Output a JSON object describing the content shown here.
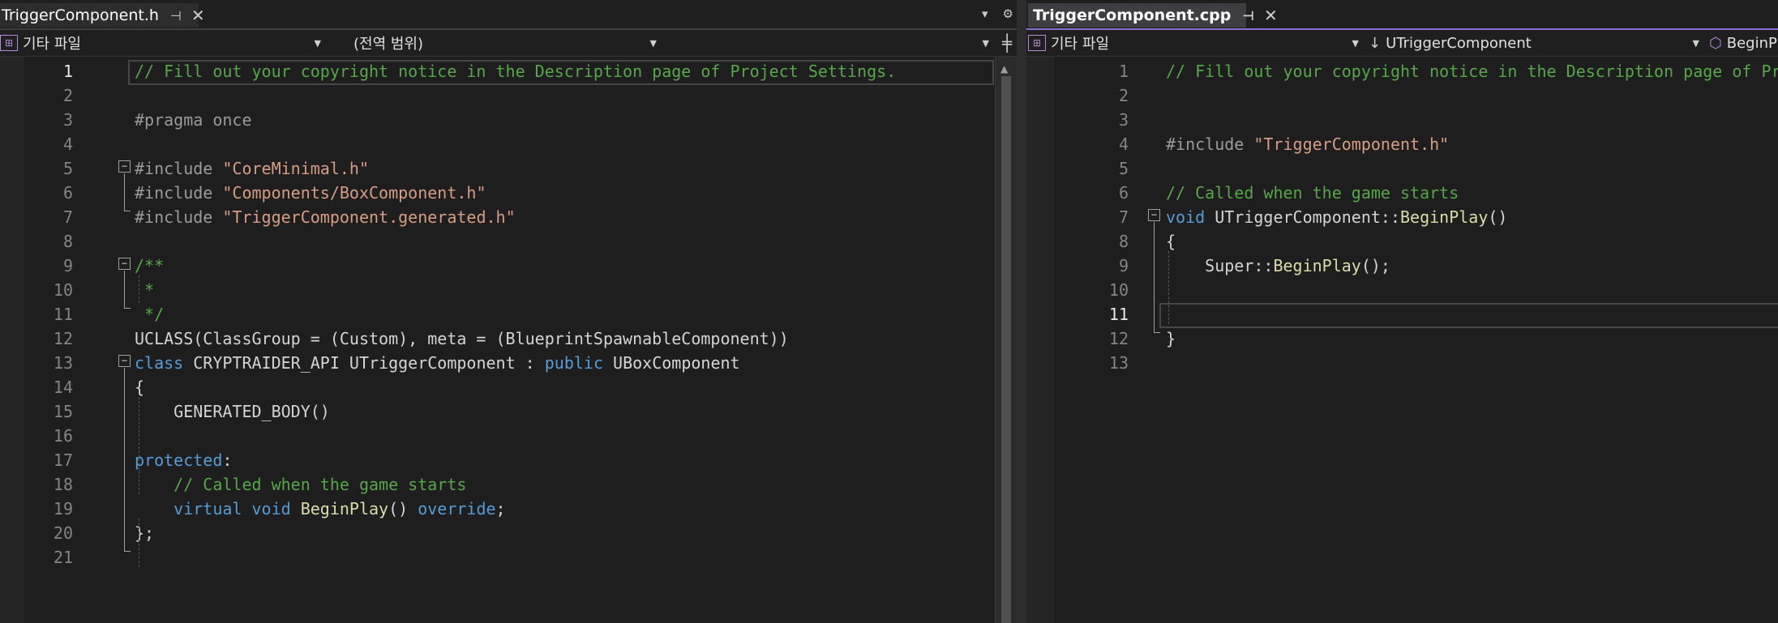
{
  "left": {
    "tab": {
      "title": "TriggerComponent.h",
      "pin_icon": "pin-icon",
      "close_icon": "close-icon"
    },
    "tabbar_tools": {
      "dropdown_glyph": "▾",
      "settings_glyph": "⚙"
    },
    "nav": {
      "project": "기타 파일",
      "scope": "(전역 범위)",
      "member": ""
    },
    "split_glyph": "╪",
    "active_line": 1,
    "lines": [
      [
        {
          "t": "// Fill out your copyright notice in the Description page of Project Settings.",
          "c": "cm"
        }
      ],
      [],
      [
        {
          "t": "#pragma once",
          "c": "pp"
        }
      ],
      [],
      [
        {
          "t": "#include ",
          "c": "pp"
        },
        {
          "t": "\"CoreMinimal.h\"",
          "c": "str"
        }
      ],
      [
        {
          "t": "#include ",
          "c": "pp"
        },
        {
          "t": "\"Components/BoxComponent.h\"",
          "c": "str"
        }
      ],
      [
        {
          "t": "#include ",
          "c": "pp"
        },
        {
          "t": "\"TriggerComponent.generated.h\"",
          "c": "str"
        }
      ],
      [],
      [
        {
          "t": "/**",
          "c": "cm"
        }
      ],
      [
        {
          "t": " *",
          "c": "cm"
        }
      ],
      [
        {
          "t": " */",
          "c": "cm"
        }
      ],
      [
        {
          "t": "UCLASS(ClassGroup = (Custom), meta = (BlueprintSpawnableComponent))",
          "c": "pl"
        }
      ],
      [
        {
          "t": "class ",
          "c": "kw"
        },
        {
          "t": "CRYPTRAIDER_API UTriggerComponent : ",
          "c": "pl"
        },
        {
          "t": "public ",
          "c": "kw"
        },
        {
          "t": "UBoxComponent",
          "c": "ty"
        }
      ],
      [
        {
          "t": "{",
          "c": "pl"
        }
      ],
      [
        {
          "t": "    GENERATED_BODY()",
          "c": "pl"
        }
      ],
      [],
      [
        {
          "t": "protected",
          "c": "kw"
        },
        {
          "t": ":",
          "c": "pl"
        }
      ],
      [
        {
          "t": "    // Called when the game starts",
          "c": "cm"
        }
      ],
      [
        {
          "t": "    ",
          "c": "pl"
        },
        {
          "t": "virtual void ",
          "c": "kw"
        },
        {
          "t": "BeginPlay",
          "c": "fn"
        },
        {
          "t": "() ",
          "c": "pl"
        },
        {
          "t": "override",
          "c": "kw"
        },
        {
          "t": ";",
          "c": "pl"
        }
      ],
      [
        {
          "t": "};",
          "c": "pl"
        }
      ],
      []
    ]
  },
  "right": {
    "tab": {
      "title": "TriggerComponent.cpp",
      "pin_icon": "pin-icon",
      "close_icon": "close-icon"
    },
    "nav": {
      "project": "기타 파일",
      "scope": "UTriggerComponent",
      "member": "BeginPla"
    },
    "active_line": 11,
    "lines": [
      [
        {
          "t": "// Fill out your copyright notice in the Description page of Pro",
          "c": "cm"
        }
      ],
      [],
      [],
      [
        {
          "t": "#include ",
          "c": "pp"
        },
        {
          "t": "\"TriggerComponent.h\"",
          "c": "str"
        }
      ],
      [],
      [
        {
          "t": "// Called when the game starts",
          "c": "cm"
        }
      ],
      [
        {
          "t": "void ",
          "c": "kw"
        },
        {
          "t": "UTriggerComponent::",
          "c": "pl"
        },
        {
          "t": "BeginPlay",
          "c": "fn"
        },
        {
          "t": "()",
          "c": "pl"
        }
      ],
      [
        {
          "t": "{",
          "c": "pl"
        }
      ],
      [
        {
          "t": "    Super::",
          "c": "pl"
        },
        {
          "t": "BeginPlay",
          "c": "fn"
        },
        {
          "t": "();",
          "c": "pl"
        }
      ],
      [],
      [],
      [
        {
          "t": "}",
          "c": "pl"
        }
      ],
      []
    ]
  }
}
